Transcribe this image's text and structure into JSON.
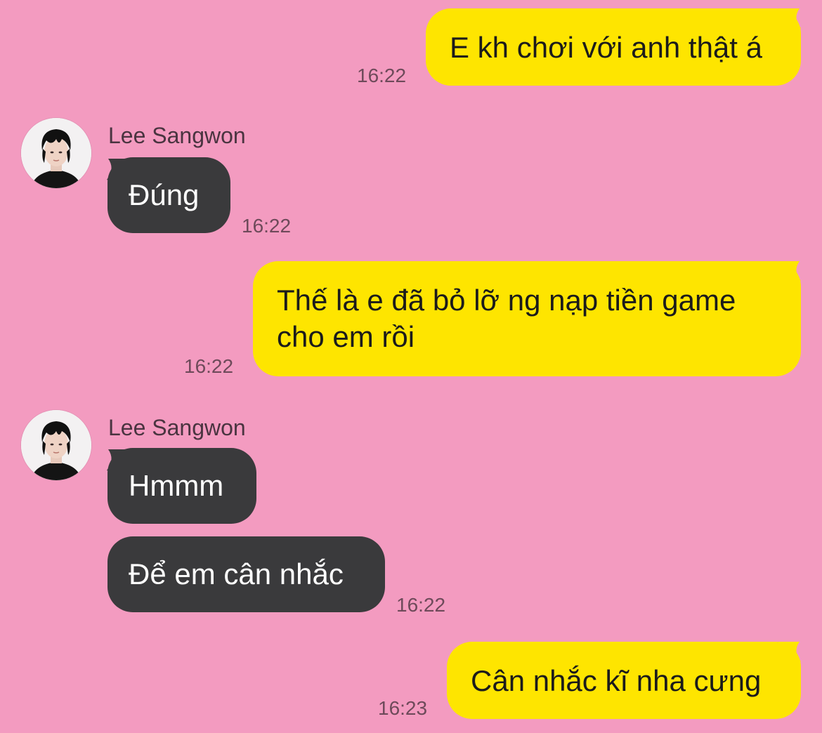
{
  "colors": {
    "background": "#F39BC0",
    "sent_bubble": "#FEE500",
    "received_bubble": "#3A3A3C"
  },
  "messages": [
    {
      "type": "sent",
      "text": "E kh chơi với anh thật á",
      "time": "16:22"
    },
    {
      "type": "received",
      "sender": "Lee Sangwon",
      "avatar_icon": "profile-photo-avatar",
      "text": "Đúng",
      "time": "16:22"
    },
    {
      "type": "sent",
      "text_line1": "Thế là e đã bỏ lỡ ng nạp tiền game",
      "text_line2": "cho em rồi",
      "time": "16:22"
    },
    {
      "type": "received",
      "sender": "Lee Sangwon",
      "avatar_icon": "profile-photo-avatar",
      "text": "Hmmm"
    },
    {
      "type": "received",
      "text": "Để em cân nhắc",
      "time": "16:22"
    },
    {
      "type": "sent",
      "text": "Cân nhắc kĩ nha cưng",
      "time": "16:23"
    }
  ]
}
